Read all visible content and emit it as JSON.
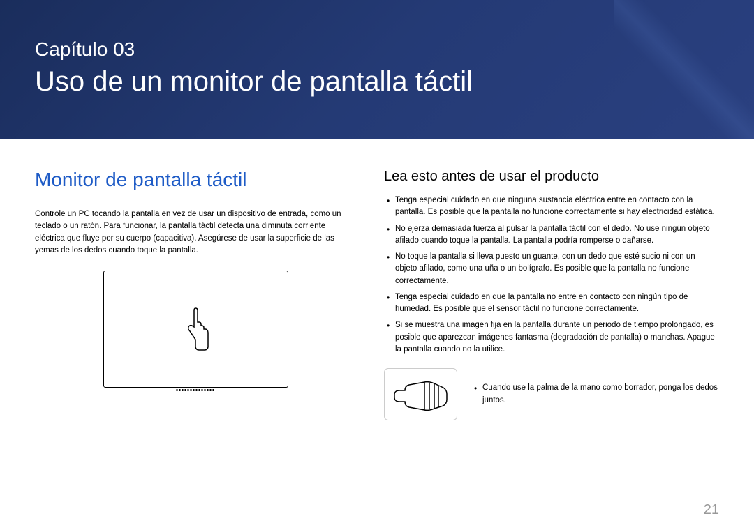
{
  "header": {
    "chapter_label": "Capítulo 03",
    "chapter_title": "Uso de un monitor de pantalla táctil"
  },
  "left": {
    "section_title": "Monitor de pantalla táctil",
    "body_text": "Controle un PC tocando la pantalla en vez de usar un dispositivo de entrada, como un teclado o un ratón. Para funcionar, la pantalla táctil detecta una diminuta corriente eléctrica que fluye por su cuerpo (capacitiva). Asegúrese de usar la superficie de las yemas de los dedos cuando toque la pantalla."
  },
  "right": {
    "section_title": "Lea esto antes de usar el producto",
    "bullets": [
      "Tenga especial cuidado en que ninguna sustancia eléctrica entre en contacto con la pantalla. Es posible que la pantalla no funcione correctamente si hay electricidad estática.",
      "No ejerza demasiada fuerza al pulsar la pantalla táctil con el dedo. No use ningún objeto afilado cuando toque la pantalla. La pantalla podría romperse o dañarse.",
      "No toque la pantalla si lleva puesto un guante, con un dedo que esté sucio ni con un objeto afilado, como una uña o un bolígrafo. Es posible que la pantalla no funcione correctamente.",
      "Tenga especial cuidado en que la pantalla no entre en contacto con ningún tipo de humedad. Es posible que el sensor táctil no funcione correctamente.",
      "Si se muestra una imagen fija en la pantalla durante un periodo de tiempo prolongado, es posible que aparezcan imágenes fantasma (degradación de pantalla) o manchas. Apague la pantalla cuando no la utilice."
    ],
    "palm_text": "Cuando use la palma de la mano como borrador, ponga los dedos juntos."
  },
  "page_number": "21"
}
